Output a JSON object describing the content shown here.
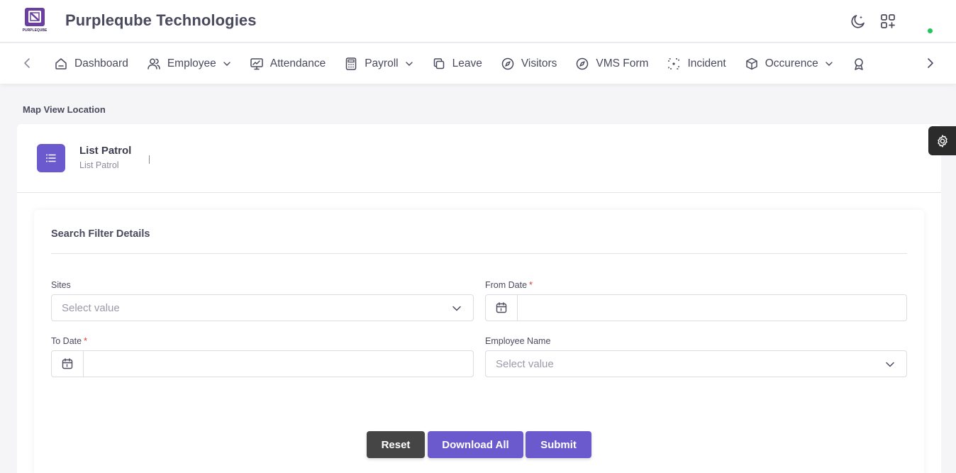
{
  "header": {
    "brand": "Purpleqube Technologies",
    "logo_text": "PURPLEQUBE",
    "icons": [
      "moon-icon",
      "apps-add-icon"
    ],
    "status_color": "#22c55e"
  },
  "nav": {
    "items": [
      {
        "label": "Dashboard",
        "icon": "home-icon",
        "dropdown": false
      },
      {
        "label": "Employee",
        "icon": "users-icon",
        "dropdown": true
      },
      {
        "label": "Attendance",
        "icon": "monitor-chart-icon",
        "dropdown": false
      },
      {
        "label": "Payroll",
        "icon": "calculator-icon",
        "dropdown": true
      },
      {
        "label": "Leave",
        "icon": "copy-icon",
        "dropdown": false
      },
      {
        "label": "Visitors",
        "icon": "compass-icon",
        "dropdown": false
      },
      {
        "label": "VMS Form",
        "icon": "compass-icon",
        "dropdown": false
      },
      {
        "label": "Incident",
        "icon": "focus-icon",
        "dropdown": false
      },
      {
        "label": "Occurence",
        "icon": "boxes-icon",
        "dropdown": true
      }
    ]
  },
  "page": {
    "breadcrumb": "Map View Location",
    "title": "List Patrol",
    "subtitle": "List Patrol"
  },
  "filter": {
    "title": "Search Filter Details",
    "sites": {
      "label": "Sites",
      "placeholder": "Select value"
    },
    "from_date": {
      "label": "From Date",
      "required": "*",
      "value": ""
    },
    "to_date": {
      "label": "To Date",
      "required": "*",
      "value": ""
    },
    "employee": {
      "label": "Employee Name",
      "placeholder": "Select value"
    }
  },
  "buttons": {
    "reset": "Reset",
    "download_all": "Download All",
    "submit": "Submit"
  },
  "colors": {
    "primary": "#6a5acd",
    "reset": "#454545",
    "required": "#e53935"
  }
}
